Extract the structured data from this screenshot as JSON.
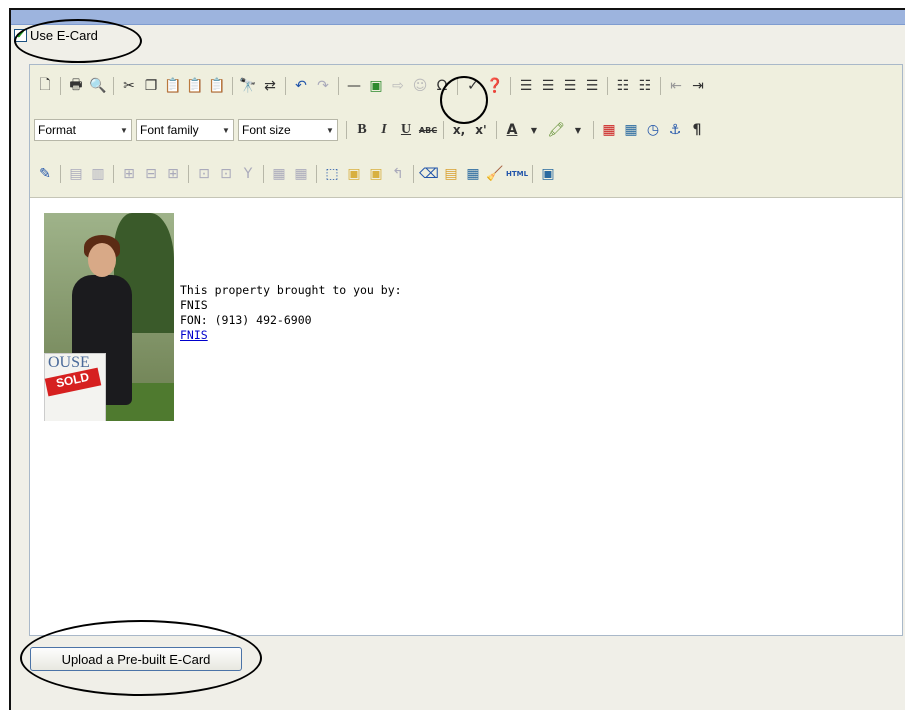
{
  "ecard": {
    "checkbox_label": "Use E-Card",
    "checked": true
  },
  "toolbar": {
    "row1_icons": [
      "new-page-icon",
      "print-icon",
      "preview-icon",
      "cut-icon",
      "copy-icon",
      "paste-icon",
      "paste-text-icon",
      "paste-word-icon",
      "find-icon",
      "replace-icon",
      "undo-icon",
      "redo-icon",
      "horizontal-rule-icon",
      "insert-image-icon",
      "flash-icon",
      "smiley-icon",
      "special-char-icon",
      "spellcheck-icon",
      "about-icon",
      "align-left-icon",
      "align-center-icon",
      "align-right-icon",
      "justify-icon",
      "bulleted-list-icon",
      "numbered-list-icon",
      "outdent-icon",
      "indent-icon"
    ],
    "format_label": "Format",
    "font_family_label": "Font family",
    "font_size_label": "Font size",
    "bold_label": "B",
    "italic_label": "I",
    "underline_label": "U",
    "strike_label": "ABC",
    "subscript_label": "x,",
    "superscript_label": "x'",
    "text_color_label": "A",
    "paragraph_label": "¶",
    "html_label": "HTML"
  },
  "content": {
    "line1": "This property brought to you by:",
    "line2": "FNIS",
    "line3": "FON: (913) 492-6900",
    "link": "FNIS",
    "sign_text_top": "OUSE",
    "sign_text_sold": "SOLD"
  },
  "footer": {
    "upload_label": "Upload a Pre-built E-Card"
  },
  "colors": {
    "accent": "#9db4de",
    "link": "#0000cc",
    "sold": "#d62020",
    "checkmark": "#21a121"
  }
}
